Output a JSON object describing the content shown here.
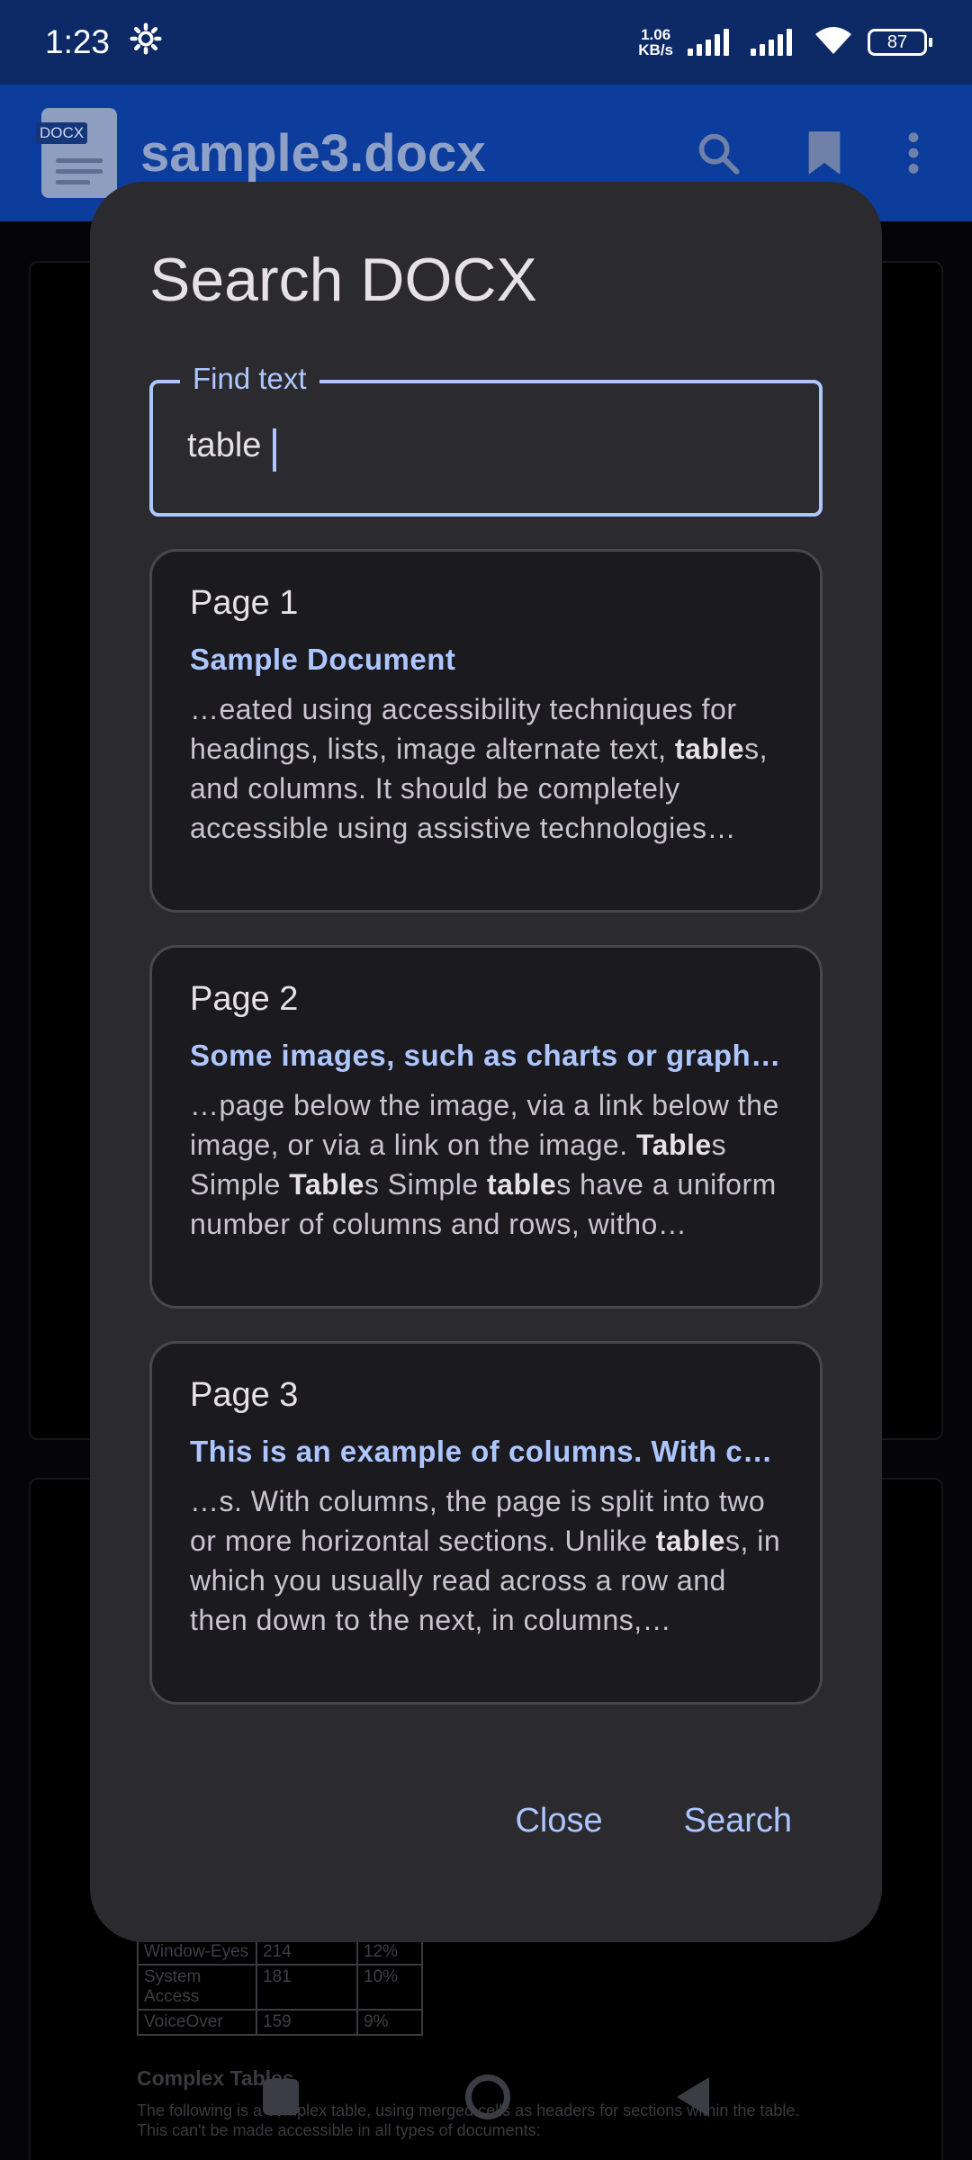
{
  "status_bar": {
    "time": "1:23",
    "net_speed_value": "1.06",
    "net_speed_unit": "KB/s",
    "battery": "87"
  },
  "app_bar": {
    "doc_tag": "DOCX",
    "title": "sample3.docx"
  },
  "background_doc": {
    "table_rows": [
      [
        "Window-Eyes",
        "214",
        "12%"
      ],
      [
        "System Access",
        "181",
        "10%"
      ],
      [
        "VoiceOver",
        "159",
        "9%"
      ]
    ],
    "heading": "Complex Tables",
    "paragraph": "The following is a complex table, using merged cells as headers for sections within the table. This can't be made accessible in all types of documents:"
  },
  "dialog": {
    "title": "Search DOCX",
    "field_label": "Find text",
    "field_value": "table",
    "results": [
      {
        "page": "Page 1",
        "heading": "Sample Document",
        "snippet_html": "…eated using accessibility techniques for headings, lists, image alternate text, <b>table</b>s, and columns. It should be completely accessible using assistive technologies…"
      },
      {
        "page": "Page 2",
        "heading": "Some images, such as charts or graphs…",
        "snippet_html": "…page below the image, via a link below the image, or via a link on the image. <b>Table</b>s Simple <b>Table</b>s Simple <b>table</b>s have a uniform number of columns and rows, witho…"
      },
      {
        "page": "Page 3",
        "heading": "This is an example of columns. With co…",
        "snippet_html": "…s. With columns, the page is split into two or more horizontal sections. Unlike <b>table</b>s, in which you usually read across a row and then down to the next, in columns,…"
      }
    ],
    "close_label": "Close",
    "search_label": "Search"
  },
  "colors": {
    "accent": "#adc6ff",
    "dialog_bg": "#2b2a2f",
    "card_bg": "#1b1a1f",
    "status_bar": "#0d2a66"
  }
}
